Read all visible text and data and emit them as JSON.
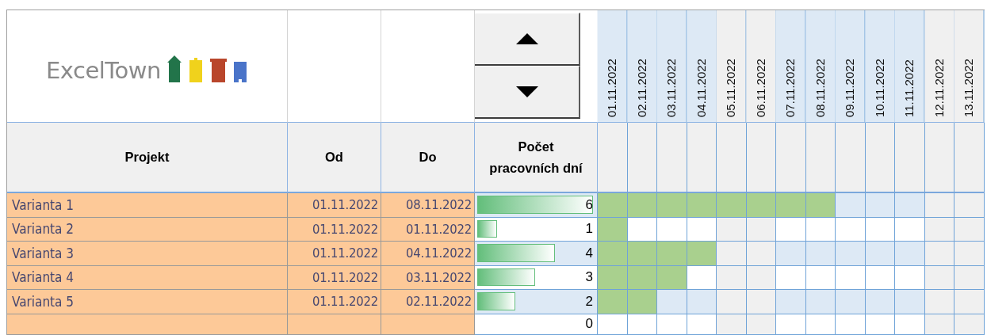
{
  "logo": {
    "text": "ExcelTown"
  },
  "scroll_buttons": [
    {
      "kind": "up"
    },
    {
      "kind": "down"
    }
  ],
  "columns": [
    "Projekt",
    "Od",
    "Do",
    "Počet pracovních dní"
  ],
  "dates": [
    {
      "label": "01.11.2022",
      "weekend": false
    },
    {
      "label": "02.11.2022",
      "weekend": false
    },
    {
      "label": "03.11.2022",
      "weekend": false
    },
    {
      "label": "04.11.2022",
      "weekend": false
    },
    {
      "label": "05.11.2022",
      "weekend": true
    },
    {
      "label": "06.11.2022",
      "weekend": true
    },
    {
      "label": "07.11.2022",
      "weekend": false
    },
    {
      "label": "08.11.2022",
      "weekend": false
    },
    {
      "label": "09.11.2022",
      "weekend": false
    },
    {
      "label": "10.11.2022",
      "weekend": false
    },
    {
      "label": "11.11.2022",
      "weekend": false
    },
    {
      "label": "12.11.2022",
      "weekend": true
    },
    {
      "label": "13.11.2022",
      "weekend": true
    }
  ],
  "rows": [
    {
      "project": "Varianta 1",
      "from": "01.11.2022",
      "to": "08.11.2022",
      "workdays": "6",
      "level": 1,
      "shaded": true,
      "cells": [
        {
          "filled": true
        },
        {
          "filled": true
        },
        {
          "filled": true
        },
        {
          "filled": true
        },
        {
          "filled": true
        },
        {
          "filled": true
        },
        {
          "filled": true
        },
        {
          "filled": true
        },
        {
          "filled": false
        },
        {
          "filled": false
        },
        {
          "filled": false
        },
        {
          "filled": false
        },
        {
          "filled": false
        }
      ]
    },
    {
      "project": "Varianta 2",
      "from": "01.11.2022",
      "to": "01.11.2022",
      "workdays": "1",
      "level": 0.17,
      "shaded": false,
      "cells": [
        {
          "filled": true
        },
        {
          "filled": false
        },
        {
          "filled": false
        },
        {
          "filled": false
        },
        {
          "filled": false
        },
        {
          "filled": false
        },
        {
          "filled": false
        },
        {
          "filled": false
        },
        {
          "filled": false
        },
        {
          "filled": false
        },
        {
          "filled": false
        },
        {
          "filled": false
        },
        {
          "filled": false
        }
      ]
    },
    {
      "project": "Varianta 3",
      "from": "01.11.2022",
      "to": "04.11.2022",
      "workdays": "4",
      "level": 0.67,
      "shaded": true,
      "cells": [
        {
          "filled": true
        },
        {
          "filled": true
        },
        {
          "filled": true
        },
        {
          "filled": true
        },
        {
          "filled": false
        },
        {
          "filled": false
        },
        {
          "filled": false
        },
        {
          "filled": false
        },
        {
          "filled": false
        },
        {
          "filled": false
        },
        {
          "filled": false
        },
        {
          "filled": false
        },
        {
          "filled": false
        }
      ]
    },
    {
      "project": "Varianta 4",
      "from": "01.11.2022",
      "to": "03.11.2022",
      "workdays": "3",
      "level": 0.5,
      "shaded": false,
      "cells": [
        {
          "filled": true
        },
        {
          "filled": true
        },
        {
          "filled": true
        },
        {
          "filled": false
        },
        {
          "filled": false
        },
        {
          "filled": false
        },
        {
          "filled": false
        },
        {
          "filled": false
        },
        {
          "filled": false
        },
        {
          "filled": false
        },
        {
          "filled": false
        },
        {
          "filled": false
        },
        {
          "filled": false
        }
      ]
    },
    {
      "project": "Varianta 5",
      "from": "01.11.2022",
      "to": "02.11.2022",
      "workdays": "2",
      "level": 0.33,
      "shaded": true,
      "cells": [
        {
          "filled": true
        },
        {
          "filled": true
        },
        {
          "filled": false
        },
        {
          "filled": false
        },
        {
          "filled": false
        },
        {
          "filled": false
        },
        {
          "filled": false
        },
        {
          "filled": false
        },
        {
          "filled": false
        },
        {
          "filled": false
        },
        {
          "filled": false
        },
        {
          "filled": false
        },
        {
          "filled": false
        }
      ]
    },
    {
      "workdays": "0",
      "shaded": false,
      "cells": [
        {
          "filled": false
        },
        {
          "filled": false
        },
        {
          "filled": false
        },
        {
          "filled": false
        },
        {
          "filled": false
        },
        {
          "filled": false
        },
        {
          "filled": false
        },
        {
          "filled": false
        },
        {
          "filled": false
        },
        {
          "filled": false
        },
        {
          "filled": false
        },
        {
          "filled": false
        },
        {
          "filled": false
        }
      ]
    }
  ]
}
